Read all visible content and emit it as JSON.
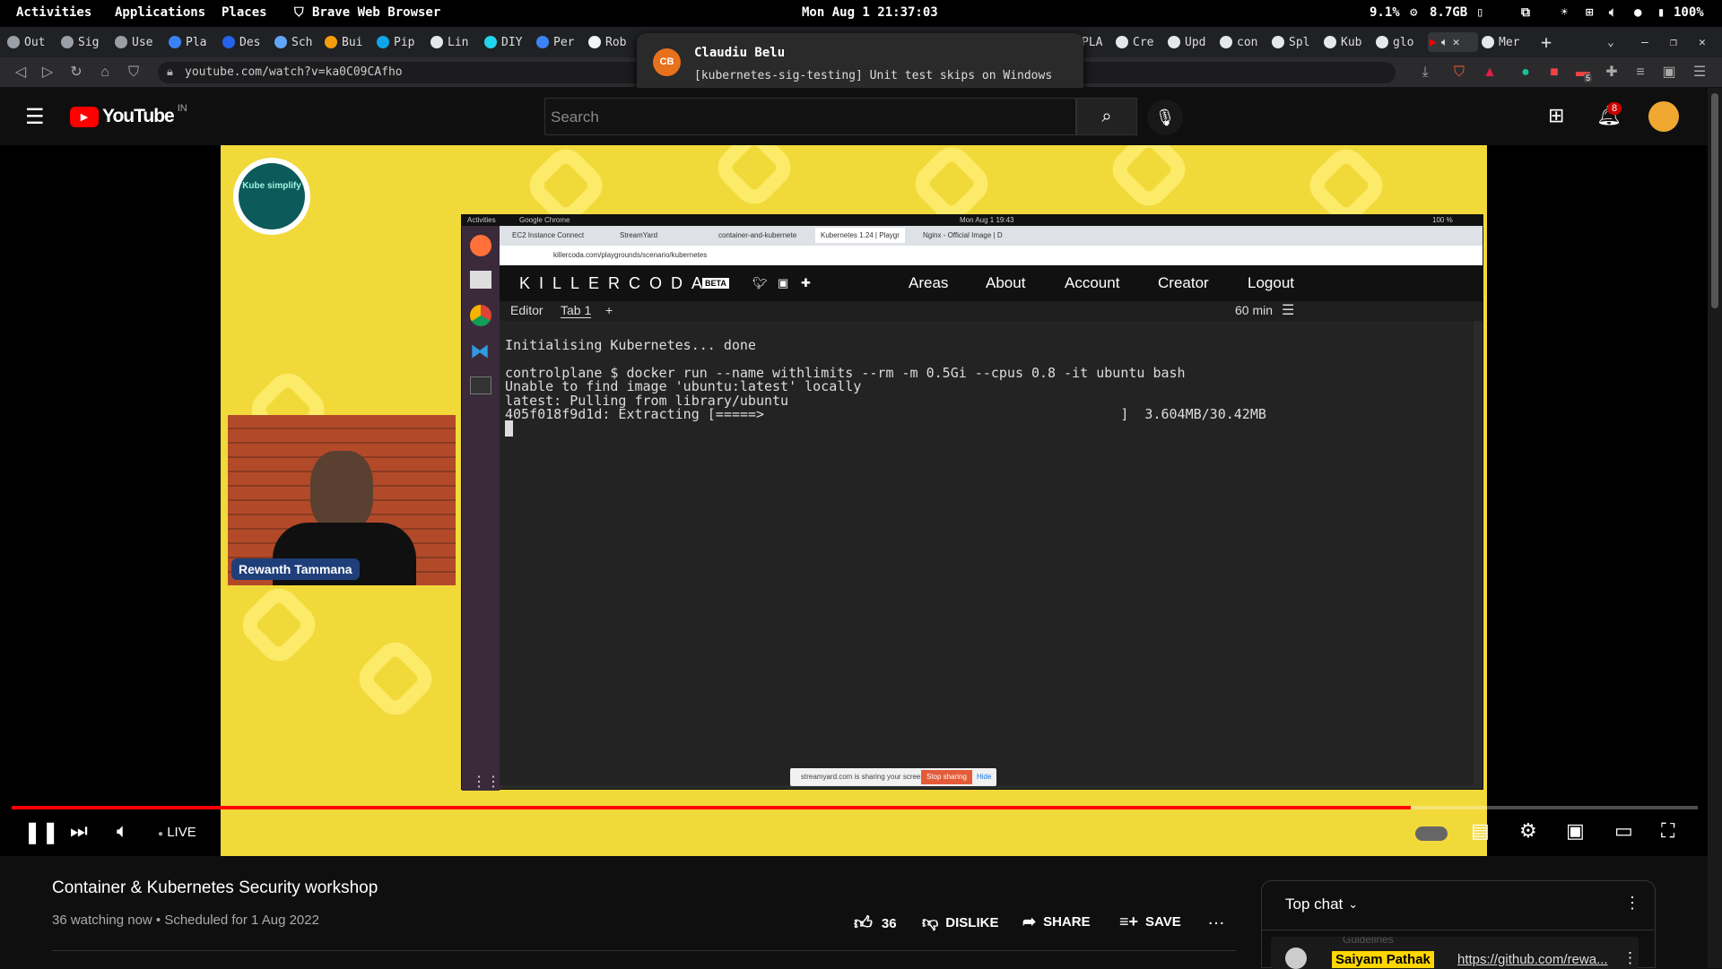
{
  "system_bar": {
    "activities": "Activities",
    "applications": "Applications",
    "places": "Places",
    "browser_name": "Brave Web Browser",
    "datetime": "Mon Aug 1 21:37:03",
    "cpu": "9.1%",
    "memory": "8.7GB",
    "battery": "100%"
  },
  "browser_tabs": [
    "Out",
    "Sig",
    "Use",
    "Pla",
    "Des",
    "Sch",
    "Bui",
    "Pip",
    "Lin",
    "DIY",
    "Per",
    "Rob",
    "PLA",
    "Cre",
    "Upd",
    "con",
    "Spl",
    "Kub",
    "glo",
    "Mer"
  ],
  "address_bar": {
    "url": "youtube.com/watch?v=ka0C09CAfho"
  },
  "extension_badge": "5",
  "notification": {
    "initials": "CB",
    "title": "Claudiu Belu",
    "body": "[kubernetes-sig-testing] Unit test skips on Windows"
  },
  "youtube": {
    "logo_text": "YouTube",
    "region": "IN",
    "search_placeholder": "Search",
    "notification_count": "8"
  },
  "video": {
    "channel_logo_text": "Kube simplify",
    "presenter_name": "Rewanth Tammana",
    "inner_os": {
      "activities": "Activities",
      "app": "Google Chrome",
      "datetime": "Mon Aug 1  19:43",
      "battery": "100 %"
    },
    "inner_tabs": [
      "EC2 Instance Connect",
      "StreamYard",
      "container-and-kubernete",
      "Kubernetes 1.24 | Playgr",
      "Nginx - Official Image | D"
    ],
    "inner_url": "killercoda.com/playgrounds/scenario/kubernetes",
    "killercoda": {
      "logo": "KILLERCODA",
      "beta": "BETA",
      "nav": [
        "Areas",
        "About",
        "Account",
        "Creator",
        "Logout"
      ],
      "editor_tabs": [
        "Editor",
        "Tab 1",
        "+"
      ],
      "timer": "60 min"
    },
    "terminal_lines": [
      "Initialising Kubernetes... done",
      "",
      "controlplane $ docker run --name withlimits --rm -m 0.5Gi --cpus 0.8 -it ubuntu bash",
      "Unable to find image 'ubuntu:latest' locally",
      "latest: Pulling from library/ubuntu",
      "405f018f9d1d: Extracting [=====>                                            ]  3.604MB/30.42MB"
    ],
    "share_banner": {
      "text": "streamyard.com is sharing your screen.",
      "stop": "Stop sharing",
      "hide": "Hide"
    }
  },
  "player": {
    "live_label": "LIVE",
    "progress_fraction": 0.83
  },
  "below_video": {
    "title": "Container & Kubernetes Security workshop",
    "meta": "36 watching now • Scheduled for 1 Aug 2022",
    "likes": "36",
    "dislike_label": "DISLIKE",
    "share_label": "SHARE",
    "save_label": "SAVE"
  },
  "chat": {
    "header": "Top chat",
    "guidelines": "Guidelines",
    "pinned_author": "Saiyam Pathak",
    "pinned_link": "https://github.com/rewa..."
  },
  "colors": {
    "yt_red": "#ff0000",
    "video_yellow": "#f2d93a",
    "notif_orange": "#e8711c"
  }
}
